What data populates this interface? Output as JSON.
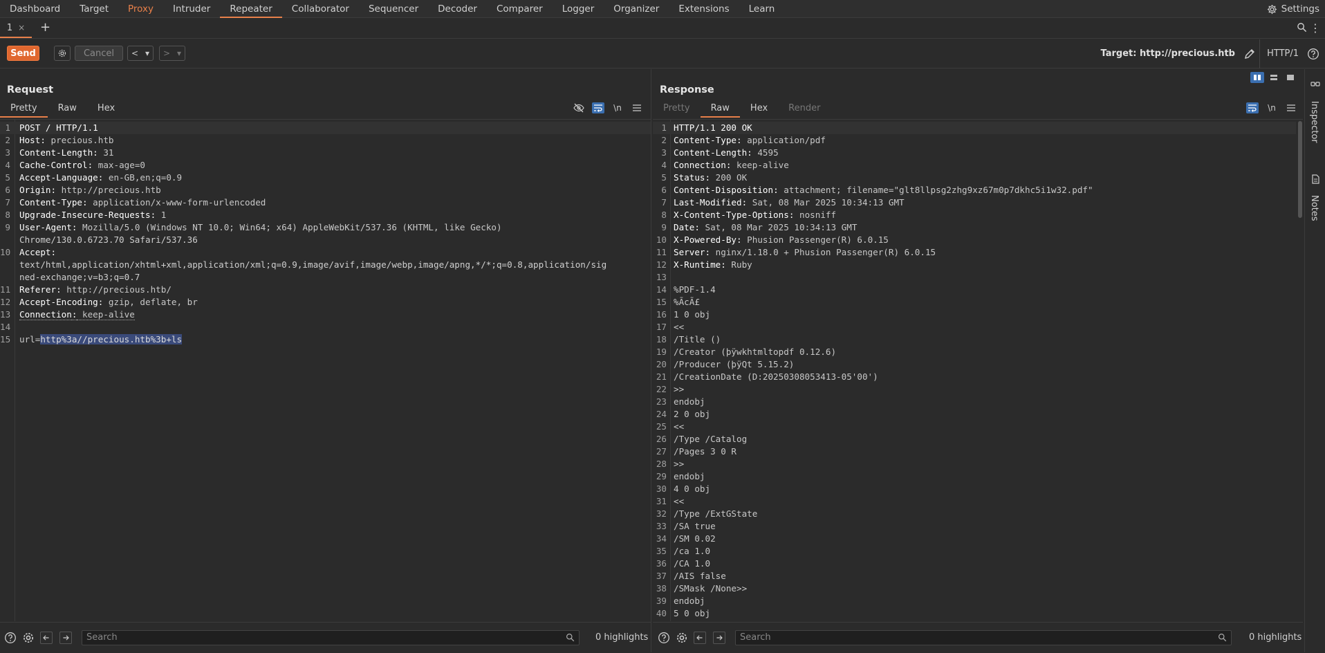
{
  "menu": {
    "items": [
      "Dashboard",
      "Target",
      "Proxy",
      "Intruder",
      "Repeater",
      "Collaborator",
      "Sequencer",
      "Decoder",
      "Comparer",
      "Logger",
      "Organizer",
      "Extensions",
      "Learn"
    ],
    "settings_label": "Settings"
  },
  "tabs": {
    "items": [
      {
        "label": "1",
        "close": "×"
      }
    ],
    "add": "+"
  },
  "toolbar": {
    "send_label": "Send",
    "cancel_label": "Cancel",
    "back_label": "<",
    "forward_label": ">",
    "dropdown": "▾",
    "target_label": "Target: http://precious.htb",
    "http_version": "HTTP/1"
  },
  "request": {
    "title": "Request",
    "tabs": [
      "Pretty",
      "Raw",
      "Hex"
    ],
    "tool_newline": "\\n",
    "lines": [
      {
        "n": "1",
        "k": "",
        "v": "POST / HTTP/1.1"
      },
      {
        "n": "2",
        "k": "Host",
        "v": " precious.htb"
      },
      {
        "n": "3",
        "k": "Content-Length",
        "v": " 31"
      },
      {
        "n": "4",
        "k": "Cache-Control",
        "v": " max-age=0"
      },
      {
        "n": "5",
        "k": "Accept-Language",
        "v": " en-GB,en;q=0.9"
      },
      {
        "n": "6",
        "k": "Origin",
        "v": " http://precious.htb"
      },
      {
        "n": "7",
        "k": "Content-Type",
        "v": " application/x-www-form-urlencoded"
      },
      {
        "n": "8",
        "k": "Upgrade-Insecure-Requests",
        "v": " 1"
      },
      {
        "n": "9",
        "k": "User-Agent",
        "v": " Mozilla/5.0 (Windows NT 10.0; Win64; x64) AppleWebKit/537.36 (KHTML, like Gecko)"
      }
    ],
    "line9_wrap": "Chrome/130.0.6723.70 Safari/537.36",
    "line10": {
      "n": "10",
      "k": "Accept",
      "v": ""
    },
    "line10_wrap1": "text/html,application/xhtml+xml,application/xml;q=0.9,image/avif,image/webp,image/apng,*/*;q=0.8,application/sig",
    "line10_wrap2": "ned-exchange;v=b3;q=0.7",
    "lines_b": [
      {
        "n": "11",
        "k": "Referer",
        "v": " http://precious.htb/"
      },
      {
        "n": "12",
        "k": "Accept-Encoding",
        "v": " gzip, deflate, br"
      }
    ],
    "line13": {
      "n": "13",
      "k": "Connection",
      "v": " keep-alive"
    },
    "line14": {
      "n": "14"
    },
    "line15": {
      "n": "15",
      "prefix": "url=",
      "selected": "http%3a//precious.htb%3b+ls"
    },
    "search_placeholder": "Search",
    "highlights": "0 highlights"
  },
  "response": {
    "title": "Response",
    "tabs": [
      "Pretty",
      "Raw",
      "Hex",
      "Render"
    ],
    "tool_newline": "\\n",
    "headers": [
      {
        "n": "1",
        "k": "",
        "v": "HTTP/1.1 200 OK"
      },
      {
        "n": "2",
        "k": "Content-Type",
        "v": " application/pdf"
      },
      {
        "n": "3",
        "k": "Content-Length",
        "v": " 4595"
      },
      {
        "n": "4",
        "k": "Connection",
        "v": " keep-alive"
      },
      {
        "n": "5",
        "k": "Status",
        "v": " 200 OK"
      },
      {
        "n": "6",
        "k": "Content-Disposition",
        "v": " attachment; filename=\"glt8llpsg2zhg9xz67m0p7dkhc5i1w32.pdf\""
      },
      {
        "n": "7",
        "k": "Last-Modified",
        "v": " Sat, 08 Mar 2025 10:34:13 GMT"
      },
      {
        "n": "8",
        "k": "X-Content-Type-Options",
        "v": " nosniff"
      },
      {
        "n": "9",
        "k": "Date",
        "v": " Sat, 08 Mar 2025 10:34:13 GMT"
      },
      {
        "n": "10",
        "k": "X-Powered-By",
        "v": " Phusion Passenger(R) 6.0.15"
      },
      {
        "n": "11",
        "k": "Server",
        "v": " nginx/1.18.0 + Phusion Passenger(R) 6.0.15"
      },
      {
        "n": "12",
        "k": "X-Runtime",
        "v": " Ruby"
      }
    ],
    "body": [
      {
        "n": "13",
        "t": ""
      },
      {
        "n": "14",
        "t": "%PDF-1.4"
      },
      {
        "n": "15",
        "t": "%ÃcÃ£"
      },
      {
        "n": "16",
        "t": "1 0 obj"
      },
      {
        "n": "17",
        "t": "<<"
      },
      {
        "n": "18",
        "t": "/Title ()"
      },
      {
        "n": "19",
        "t": "/Creator (þÿwkhtmltopdf 0.12.6)"
      },
      {
        "n": "20",
        "t": "/Producer (þÿQt 5.15.2)"
      },
      {
        "n": "21",
        "t": "/CreationDate (D:20250308053413-05'00')"
      },
      {
        "n": "22",
        "t": ">>"
      },
      {
        "n": "23",
        "t": "endobj"
      },
      {
        "n": "24",
        "t": "2 0 obj"
      },
      {
        "n": "25",
        "t": "<<"
      },
      {
        "n": "26",
        "t": "/Type /Catalog"
      },
      {
        "n": "27",
        "t": "/Pages 3 0 R"
      },
      {
        "n": "28",
        "t": ">>"
      },
      {
        "n": "29",
        "t": "endobj"
      },
      {
        "n": "30",
        "t": "4 0 obj"
      },
      {
        "n": "31",
        "t": "<<"
      },
      {
        "n": "32",
        "t": "/Type /ExtGState"
      },
      {
        "n": "33",
        "t": "/SA true"
      },
      {
        "n": "34",
        "t": "/SM 0.02"
      },
      {
        "n": "35",
        "t": "/ca 1.0"
      },
      {
        "n": "36",
        "t": "/CA 1.0"
      },
      {
        "n": "37",
        "t": "/AIS false"
      },
      {
        "n": "38",
        "t": "/SMask /None>>"
      },
      {
        "n": "39",
        "t": "endobj"
      },
      {
        "n": "40",
        "t": "5 0 obj"
      }
    ],
    "search_placeholder": "Search",
    "highlights": "0 highlights"
  },
  "sidebar": {
    "inspector": "Inspector",
    "notes": "Notes"
  },
  "colors": {
    "accent": "#e8804a",
    "send": "#e0672f",
    "selection": "#3a4a7a",
    "active_tool": "#3b6fb0"
  },
  "icons": [
    "gear-icon",
    "search-icon",
    "more-vertical-icon",
    "pencil-icon",
    "help-icon",
    "eye-off-icon",
    "wrap-icon",
    "menu-icon",
    "arrow-left-icon",
    "arrow-right-icon",
    "inspector-icon",
    "notes-icon"
  ]
}
